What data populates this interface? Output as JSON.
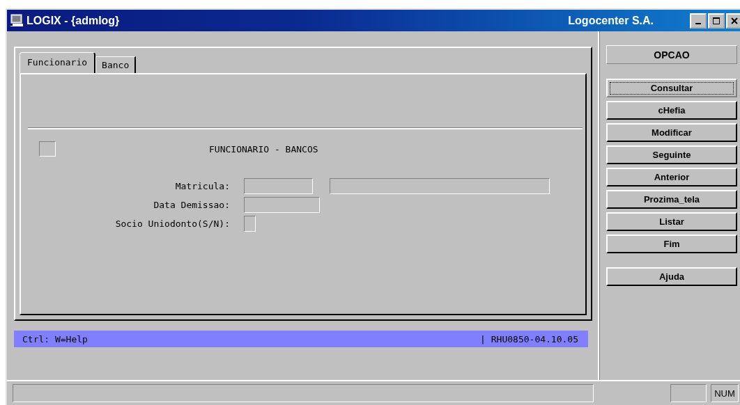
{
  "window": {
    "title": "LOGIX - {admlog}",
    "company": "Logocenter S.A."
  },
  "tabs": [
    {
      "label": "Funcionario",
      "selected": true
    },
    {
      "label": "Banco",
      "selected": false
    }
  ],
  "form": {
    "title": "FUNCIONARIO - BANCOS",
    "checkbox": {
      "checked": false
    },
    "fields": [
      {
        "label": "Matricula:",
        "kind": "pair"
      },
      {
        "label": "Data Demissao:",
        "kind": "date"
      },
      {
        "label": "Socio Uniodonto(S/N):",
        "kind": "flag"
      }
    ]
  },
  "help_bar": {
    "left": "Ctrl: W=Help",
    "right": "| RHU0850-04.10.05"
  },
  "options": {
    "title": "OPCAO",
    "buttons": [
      {
        "label": "Consultar",
        "focused": true
      },
      {
        "label": "cHefia",
        "focused": false
      },
      {
        "label": "Modificar",
        "focused": false
      },
      {
        "label": "Seguinte",
        "focused": false
      },
      {
        "label": "Anterior",
        "focused": false
      },
      {
        "label": "Prozima_tela",
        "focused": false
      },
      {
        "label": "Listar",
        "focused": false
      },
      {
        "label": "Fim",
        "focused": false
      }
    ],
    "help_button": "Ajuda"
  },
  "status_bar": {
    "indicator": "NUM"
  }
}
